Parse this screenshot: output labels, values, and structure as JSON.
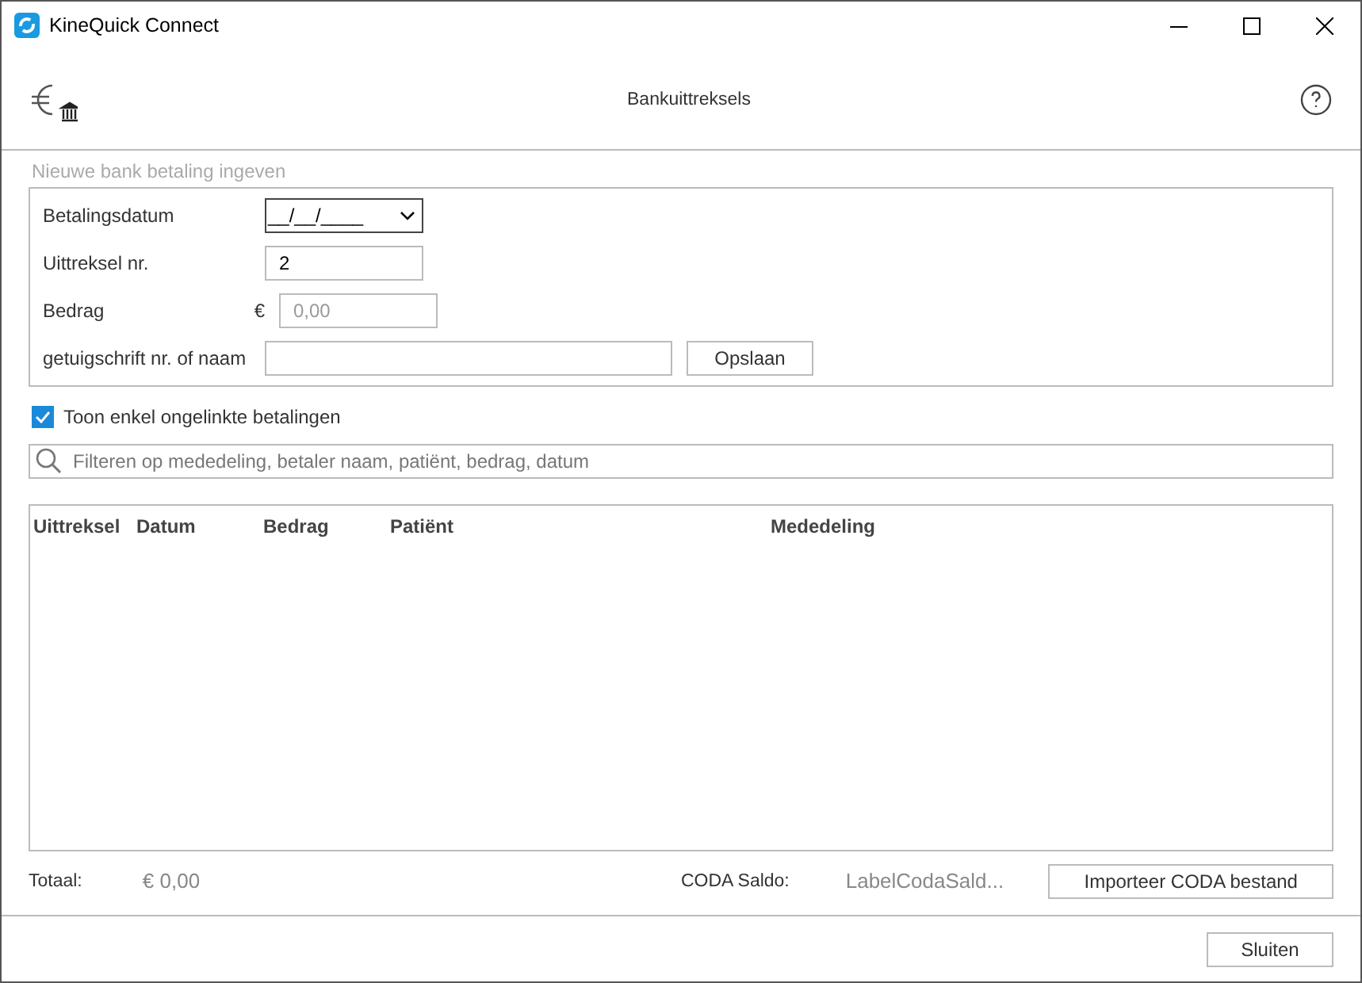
{
  "window": {
    "title": "KineQuick Connect"
  },
  "header": {
    "title": "Bankuittreksels"
  },
  "new_payment": {
    "title": "Nieuwe bank betaling ingeven",
    "fields": [
      {
        "kind": "dropdown",
        "label": "Betalingsdatum",
        "value": "__/__/____"
      },
      {
        "kind": "text",
        "label": "Uittreksel nr.",
        "value": "2"
      },
      {
        "kind": "amount",
        "label": "Bedrag",
        "currency": "€",
        "placeholder": "0,00"
      },
      {
        "kind": "wide",
        "label": "getuigschrift nr. of naam",
        "button": "Opslaan"
      }
    ]
  },
  "filter_unlinked": {
    "label": "Toon enkel ongelinkte betalingen",
    "checked": true
  },
  "search": {
    "placeholder": "Filteren op mededeling, betaler naam, patiënt, bedrag, datum"
  },
  "table": {
    "columns": [
      "Uittreksel",
      "Datum",
      "Bedrag",
      "Patiënt",
      "Mededeling"
    ]
  },
  "footer": {
    "total_label": "Totaal:",
    "total_value": "€ 0,00",
    "coda_label": "CODA Saldo:",
    "coda_value": "LabelCodaSald...",
    "import_button": "Importeer CODA bestand"
  },
  "buttons": [
    "Sluiten"
  ]
}
